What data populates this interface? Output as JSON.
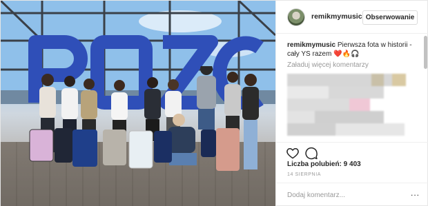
{
  "header": {
    "username": "remikmymusic",
    "follow_label": "Obserwowanie"
  },
  "caption": {
    "username": "remikmymusic",
    "text": "Pierwsza fota w historii - cały YS razem ❤️🔥🎧"
  },
  "comments": {
    "load_more": "Załaduj więcej komentarzy"
  },
  "actions": {
    "like_icon": "heart-icon",
    "comment_icon": "comment-icon"
  },
  "likes": {
    "text": "Liczba polubień: 9 403"
  },
  "date": "14 SIERPNIA",
  "add_comment": {
    "placeholder": "Dodaj komentarz...",
    "more_label": "..."
  },
  "photo": {
    "sign_text": "POZ"
  }
}
